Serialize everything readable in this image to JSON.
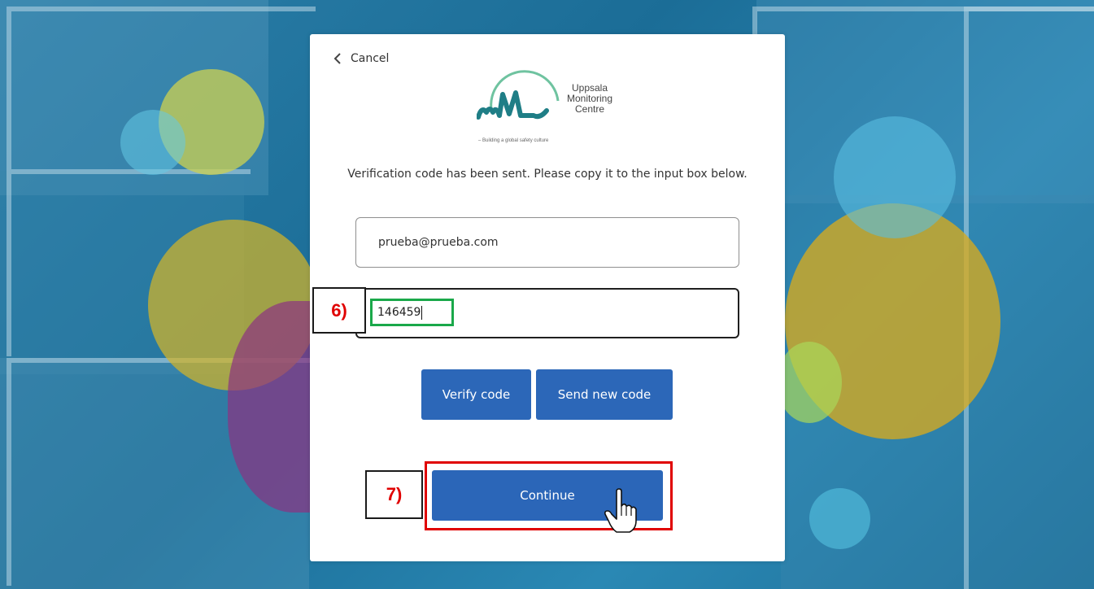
{
  "background": {
    "accent_colors": [
      "#1d6f9a",
      "#c8c83a",
      "#5bb8d6",
      "#8a3a8a",
      "#d9a21a"
    ]
  },
  "card": {
    "cancel_label": "Cancel",
    "logo": {
      "name_line1": "Uppsala",
      "name_line2": "Monitoring",
      "name_line3": "Centre",
      "tagline": "– Building a global safety culture",
      "brand_color": "#2ea3a3"
    },
    "intro_text": "Verification code has been sent. Please copy it to the input box below.",
    "email_value": "prueba@prueba.com",
    "code_value": "146459",
    "buttons": {
      "verify": "Verify code",
      "send_new": "Send new code",
      "continue": "Continue"
    },
    "button_color": "#2c67b8"
  },
  "annotations": {
    "step6": "6)",
    "step7": "7)",
    "highlight_red": "#e00000",
    "highlight_green": "#1aa84a"
  }
}
